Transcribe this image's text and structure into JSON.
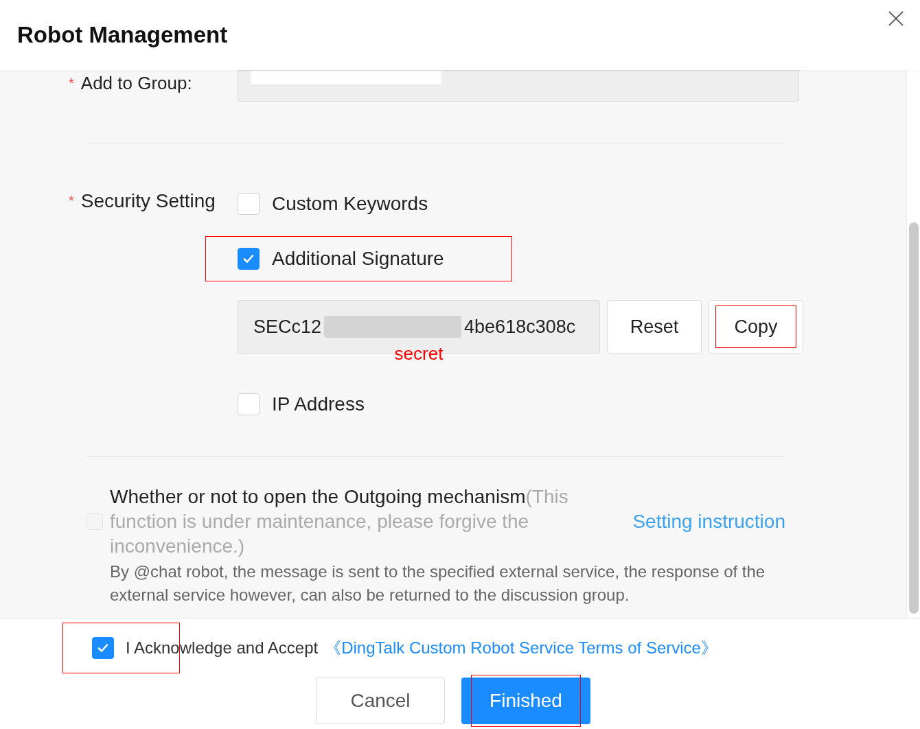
{
  "dialog": {
    "title": "Robot Management"
  },
  "group": {
    "label": "Add to Group:",
    "required_mark": "*"
  },
  "security": {
    "label": "Security Setting",
    "required_mark": "*",
    "options": [
      {
        "kind": "checkbox",
        "label": "Custom Keywords",
        "checked": false,
        "highlighted": false
      },
      {
        "kind": "checkbox",
        "label": "Additional Signature",
        "checked": true,
        "highlighted": true
      },
      {
        "kind": "secret",
        "value_start": "SECc12",
        "value_end": "4be618c308c",
        "note": "secret",
        "buttons": [
          {
            "label": "Reset",
            "highlighted": false
          },
          {
            "label": "Copy",
            "highlighted": true
          }
        ]
      },
      {
        "kind": "checkbox",
        "label": "IP Address",
        "checked": false,
        "highlighted": false
      }
    ]
  },
  "outgoing": {
    "checked": false,
    "disabled": true,
    "title": "Whether or not to open the Outgoing mechanism",
    "note": "(This function is under maintenance, please forgive the inconvenience.)",
    "link": "Setting instruction",
    "description": "By @chat robot, the message is sent to the specified external service, the response of the external service however, can also be returned to the discussion group."
  },
  "agreement": {
    "checked": true,
    "highlighted": true,
    "text": "I Acknowledge and Accept",
    "link": "《DingTalk Custom Robot Service Terms of Service》"
  },
  "buttons": [
    {
      "kind": "secondary",
      "label": "Cancel",
      "highlighted": false
    },
    {
      "kind": "primary",
      "label": "Finished",
      "highlighted": true
    }
  ]
}
